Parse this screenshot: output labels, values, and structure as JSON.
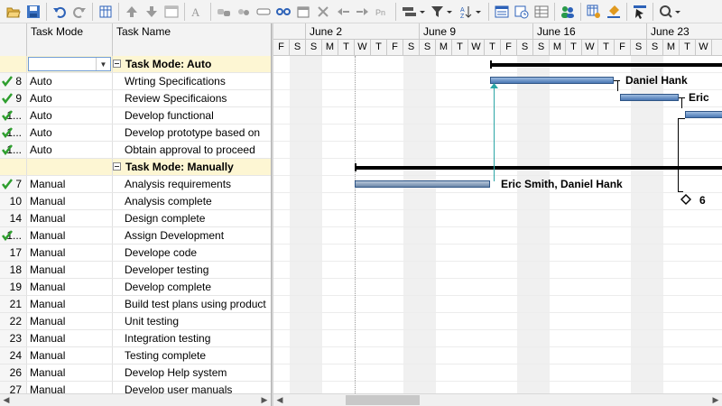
{
  "columns": {
    "mode": "Task Mode",
    "name": "Task Name"
  },
  "week_labels": [
    "June 2",
    "June 9",
    "June 16",
    "June 23"
  ],
  "day_letters": [
    "F",
    "S",
    "S",
    "M",
    "T",
    "W",
    "T",
    "F",
    "S",
    "S",
    "M",
    "T",
    "W",
    "T",
    "F",
    "S",
    "S",
    "M",
    "T",
    "W",
    "T",
    "F",
    "S",
    "S",
    "M",
    "T",
    "W"
  ],
  "rows": [
    {
      "type": "summary",
      "id": "",
      "mode": "",
      "name": "Task Mode: Auto"
    },
    {
      "type": "task",
      "id": "8",
      "check": true,
      "mode": "Auto",
      "name": "Wrting Specifications"
    },
    {
      "type": "task",
      "id": "9",
      "check": true,
      "mode": "Auto",
      "name": "Review Specificaions"
    },
    {
      "type": "task",
      "id": "1...",
      "check": true,
      "mode": "Auto",
      "name": "Develop functional"
    },
    {
      "type": "task",
      "id": "1...",
      "check": true,
      "mode": "Auto",
      "name": "Develop prototype based on"
    },
    {
      "type": "task",
      "id": "1...",
      "check": true,
      "mode": "Auto",
      "name": "Obtain approval to proceed"
    },
    {
      "type": "summary",
      "id": "",
      "mode": "",
      "name": "Task Mode: Manually"
    },
    {
      "type": "task",
      "id": "7",
      "check": true,
      "mode": "Manual",
      "name": "Analysis requirements"
    },
    {
      "type": "task",
      "id": "10",
      "check": false,
      "mode": "Manual",
      "name": "Analysis complete"
    },
    {
      "type": "task",
      "id": "14",
      "check": false,
      "mode": "Manual",
      "name": "Design complete"
    },
    {
      "type": "task",
      "id": "1...",
      "check": true,
      "mode": "Manual",
      "name": "Assign Development"
    },
    {
      "type": "task",
      "id": "17",
      "check": false,
      "mode": "Manual",
      "name": "Develope code"
    },
    {
      "type": "task",
      "id": "18",
      "check": false,
      "mode": "Manual",
      "name": "Developer testing"
    },
    {
      "type": "task",
      "id": "19",
      "check": false,
      "mode": "Manual",
      "name": "Develop complete"
    },
    {
      "type": "task",
      "id": "21",
      "check": false,
      "mode": "Manual",
      "name": "Build test plans using product"
    },
    {
      "type": "task",
      "id": "22",
      "check": false,
      "mode": "Manual",
      "name": "Unit testing"
    },
    {
      "type": "task",
      "id": "23",
      "check": false,
      "mode": "Manual",
      "name": "Integration testing"
    },
    {
      "type": "task",
      "id": "24",
      "check": false,
      "mode": "Manual",
      "name": "Testing complete"
    },
    {
      "type": "task",
      "id": "26",
      "check": false,
      "mode": "Manual",
      "name": "Develop Help system"
    },
    {
      "type": "task",
      "id": "27",
      "check": false,
      "mode": "Manual",
      "name": "Develop user manuals"
    }
  ],
  "gantt": {
    "label_daniel": "Daniel Hank",
    "label_eric_trunc": "Eric",
    "label_eric_daniel": "Eric Smith, Daniel Hank",
    "label_milestone": "6"
  },
  "colors": {
    "summary_row": "#fdf6d3",
    "bar": "#4a77b4",
    "link": "#2aa5a5",
    "check": "#2e9e2e"
  },
  "toolbar_icons": [
    "open-folder-icon",
    "save-icon",
    "undo-icon",
    "redo-icon",
    "columns-icon",
    "move-up-icon",
    "move-down-icon",
    "form-icon",
    "font-icon",
    "link-icon",
    "unlink-icon",
    "split-icon",
    "chain-icon",
    "calendar-icon",
    "delete-icon",
    "outdent-icon",
    "indent-icon",
    "progress-icon",
    "zoom-bar-icon",
    "filter-icon",
    "sort-icon",
    "table-icon",
    "timeline-icon",
    "grid-icon",
    "resources-icon",
    "calendar-settings-icon",
    "highlight-icon",
    "pointer-icon",
    "search-icon"
  ]
}
